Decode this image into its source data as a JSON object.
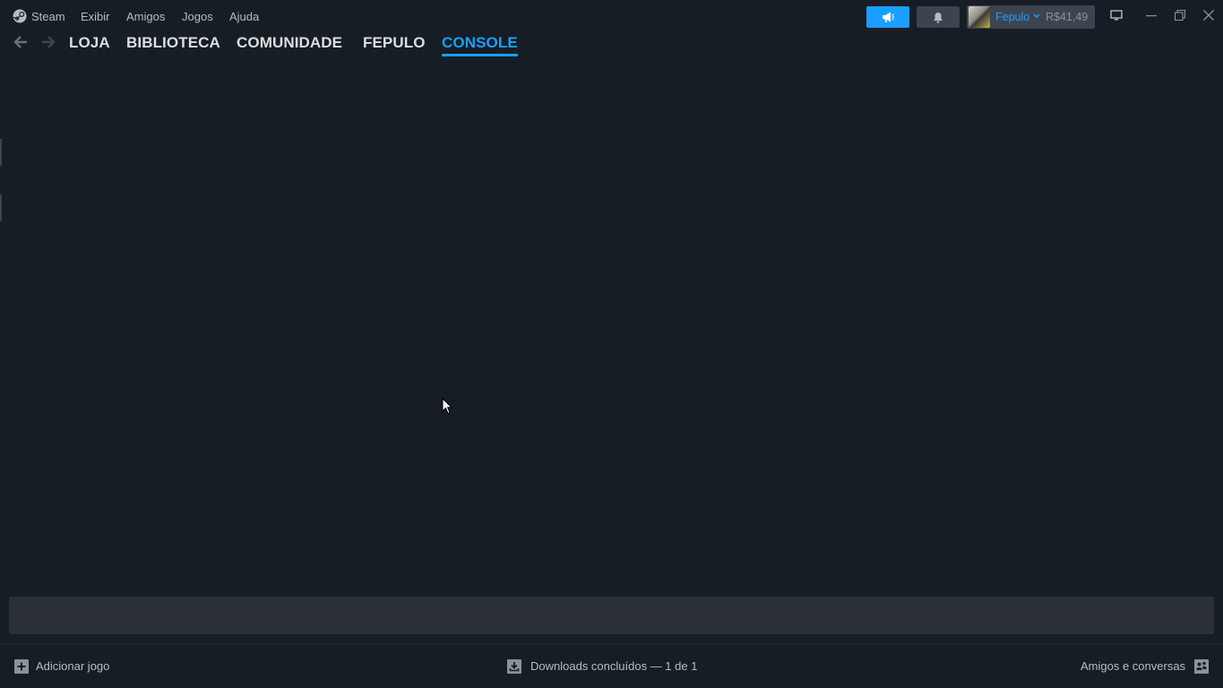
{
  "menu": {
    "steam": "Steam",
    "exibir": "Exibir",
    "amigos": "Amigos",
    "jogos": "Jogos",
    "ajuda": "Ajuda"
  },
  "account": {
    "name": "Fepulo",
    "balance": "R$41,49"
  },
  "nav": {
    "tabs": [
      "LOJA",
      "BIBLIOTECA",
      "COMUNIDADE",
      "FEPULO",
      "CONSOLE"
    ],
    "active": "CONSOLE"
  },
  "console": {
    "input_value": ""
  },
  "footer": {
    "add_game": "Adicionar jogo",
    "downloads": "Downloads concluídos — 1 de 1",
    "friends": "Amigos e conversas"
  },
  "colors": {
    "background": "#171d25",
    "accent": "#1a9fff",
    "button_gray": "#3d4450",
    "input_bg": "#2a2f38"
  },
  "icons": {
    "steam_logo": "steam-logo-icon",
    "announce": "megaphone-icon",
    "notifications": "bell-icon",
    "chevron": "chevron-down-icon",
    "big_picture": "monitor-icon",
    "minimize": "minimize-icon",
    "restore": "restore-icon",
    "close": "close-icon",
    "back": "back-arrow-icon",
    "forward": "forward-arrow-icon",
    "add": "plus-square-icon",
    "download": "download-icon",
    "friends": "friends-icon"
  }
}
